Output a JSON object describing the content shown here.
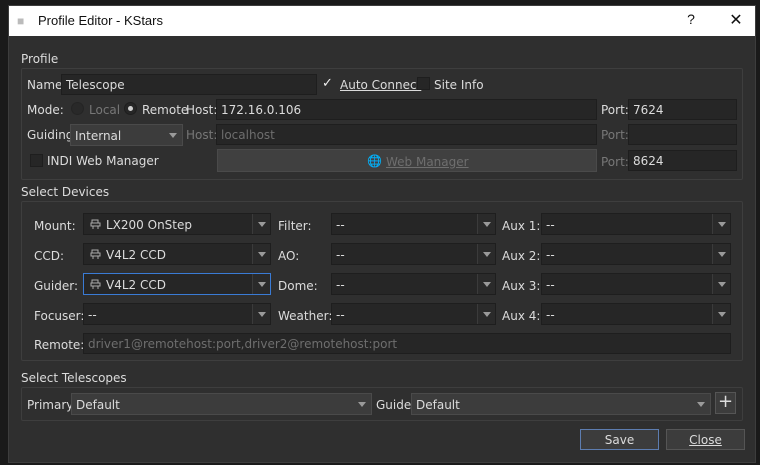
{
  "window": {
    "title": "Profile Editor - KStars",
    "help": "?",
    "close": "✕"
  },
  "profile": {
    "section": "Profile",
    "name_label": "Name:",
    "name_value": "Telescope",
    "auto_connect_label": "Auto Connect",
    "auto_connect_checked": true,
    "site_info_label": "Site Info",
    "mode_label": "Mode:",
    "mode_local": "Local",
    "mode_remote": "Remote",
    "host_label": "Host:",
    "host_value": "172.16.0.106",
    "port_label": "Port:",
    "port_value": "7624",
    "guiding_label": "Guiding:",
    "guiding_value": "Internal",
    "guide_host_label": "Host:",
    "guide_host_placeholder": "localhost",
    "guide_port_label": "Port:",
    "indi_web_manager_label": "INDI Web Manager",
    "web_manager_button": "Web Manager",
    "web_port_label": "Port:",
    "web_port_value": "8624"
  },
  "devices": {
    "section": "Select Devices",
    "mount_label": "Mount:",
    "mount_value": "LX200 OnStep",
    "ccd_label": "CCD:",
    "ccd_value": "V4L2 CCD",
    "guider_label": "Guider:",
    "guider_value": "V4L2 CCD",
    "focuser_label": "Focuser:",
    "focuser_value": "--",
    "filter_label": "Filter:",
    "filter_value": "--",
    "ao_label": "AO:",
    "ao_value": "--",
    "dome_label": "Dome:",
    "dome_value": "--",
    "weather_label": "Weather:",
    "weather_value": "--",
    "aux1_label": "Aux 1:",
    "aux1_value": "--",
    "aux2_label": "Aux 2:",
    "aux2_value": "--",
    "aux3_label": "Aux 3:",
    "aux3_value": "--",
    "aux4_label": "Aux 4:",
    "aux4_value": "--",
    "remote_label": "Remote:",
    "remote_placeholder": "driver1@remotehost:port,driver2@remotehost:port"
  },
  "telescopes": {
    "section": "Select Telescopes",
    "primary_label": "Primary:",
    "primary_value": "Default",
    "guide_label": "Guide:",
    "guide_value": "Default",
    "add_button": "+"
  },
  "buttons": {
    "save": "Save",
    "close": "Close"
  },
  "colors": {
    "background": "#2f2f2f",
    "field": "#262626",
    "accent": "#5d7db0"
  }
}
